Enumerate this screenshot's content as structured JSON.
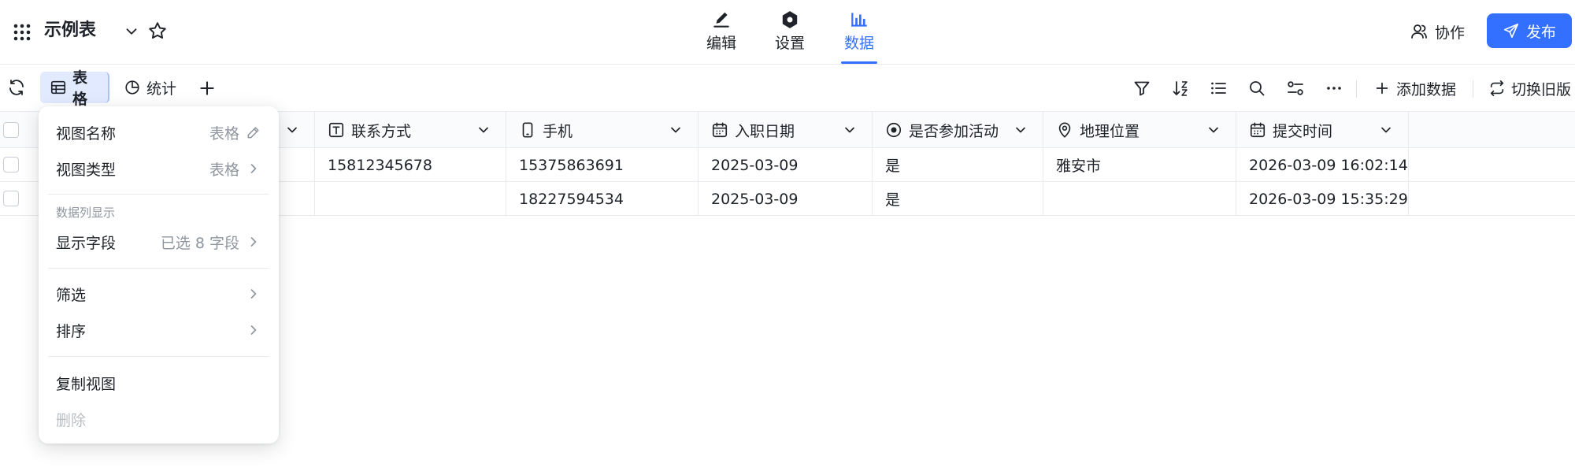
{
  "app": {
    "title": "示例表"
  },
  "nav": {
    "tabs": [
      {
        "label": "编辑"
      },
      {
        "label": "设置"
      },
      {
        "label": "数据"
      }
    ],
    "active_index": 2
  },
  "header_actions": {
    "collab_label": "协作",
    "publish_label": "发布"
  },
  "colors": {
    "accent": "#3370ff",
    "active_tab_bg": "#e1eaff"
  },
  "toolbar": {
    "views": [
      {
        "label": "表格",
        "icon": "table-icon"
      },
      {
        "label": "统计",
        "icon": "pie-chart-icon"
      }
    ],
    "add_data_label": "添加数据",
    "switch_old_label": "切换旧版",
    "icons": [
      "filter-icon",
      "sort-icon",
      "list-icon",
      "search-icon",
      "row-height-icon",
      "more-icon"
    ]
  },
  "table": {
    "columns": [
      {
        "label": "联系方式",
        "icon": "text-icon"
      },
      {
        "label": "手机",
        "icon": "phone-icon"
      },
      {
        "label": "入职日期",
        "icon": "calendar-icon"
      },
      {
        "label": "是否参加活动",
        "icon": "radio-icon"
      },
      {
        "label": "地理位置",
        "icon": "location-icon"
      },
      {
        "label": "提交时间",
        "icon": "calendar-icon"
      }
    ],
    "rows": [
      [
        "15812345678",
        "15375863691",
        "2025-03-09",
        "是",
        "雅安市",
        "2026-03-09 16:02:14"
      ],
      [
        "",
        "18227594534",
        "2025-03-09",
        "是",
        "",
        "2026-03-09 15:35:29"
      ]
    ]
  },
  "menu": {
    "view_name": {
      "label": "视图名称",
      "value": "表格"
    },
    "view_type": {
      "label": "视图类型",
      "value": "表格"
    },
    "group_label": "数据列显示",
    "display_fields": {
      "label": "显示字段",
      "value": "已选 8 字段"
    },
    "filter_label": "筛选",
    "sort_label": "排序",
    "copy_label": "复制视图",
    "delete_label": "删除"
  }
}
